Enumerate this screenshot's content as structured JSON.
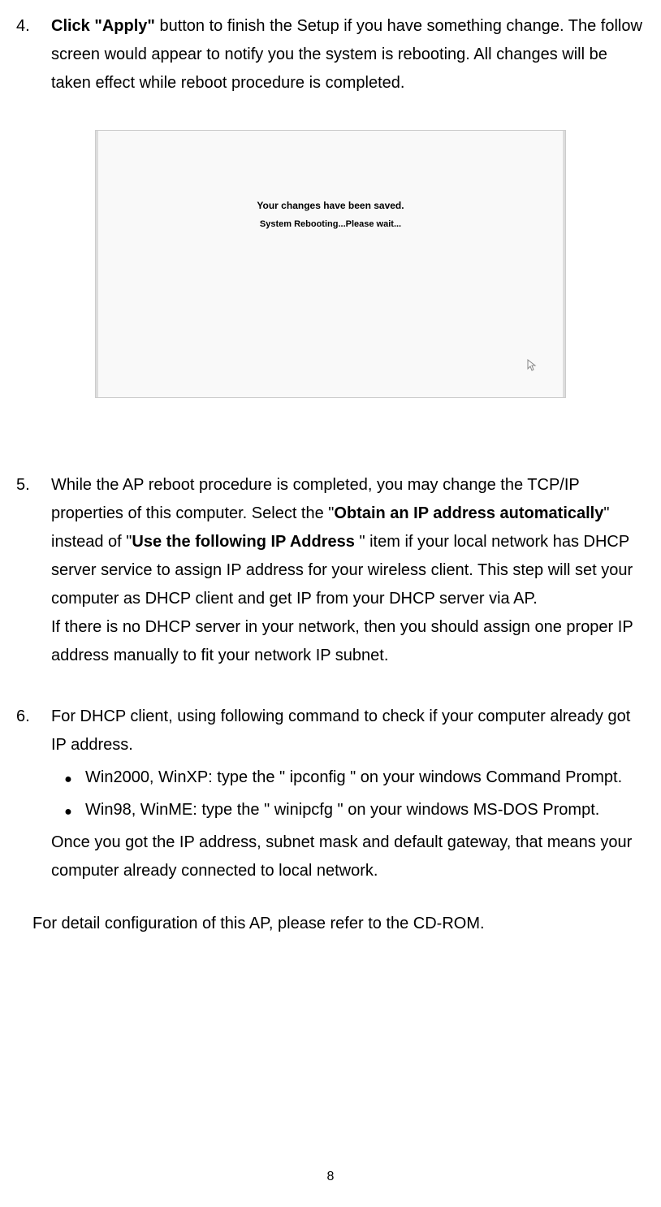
{
  "items": {
    "item4": {
      "number": "4.",
      "bold_lead": "Click \"Apply\"",
      "text_rest": " button to finish the Setup if you have something change. The follow screen would appear to notify you the system is rebooting. All changes will be taken effect while reboot procedure is completed."
    },
    "item5": {
      "number": "5.",
      "text_part1": "While the AP reboot procedure is completed, you may change the TCP/IP properties of this computer. Select the \"",
      "bold1": "Obtain an IP address automatically",
      "text_part2": "\" instead of \"",
      "bold2": "Use the following IP Address",
      "text_part3": " \" item if your local network has DHCP server service to assign IP address for your wireless client. This step will set your computer as DHCP client and get IP from your DHCP server via AP.",
      "text_part4": "If there is no DHCP server in your network, then you should assign one proper IP address manually to fit your network IP subnet."
    },
    "item6": {
      "number": "6.",
      "text_intro": "For DHCP client, using following command to check if your computer already got IP address.",
      "bullet1": "Win2000, WinXP: type the \" ipconfig \" on your windows Command Prompt.",
      "bullet2": "Win98, WinME: type the \" winipcfg \" on your windows MS-DOS Prompt.",
      "text_outro": "Once you got the IP address, subnet mask and default gateway, that means your computer already connected to local network."
    }
  },
  "screenshot": {
    "line1": "Your changes have been saved.",
    "line2": "System Rebooting...Please wait..."
  },
  "final_note": "For detail configuration of this AP, please refer to the CD-ROM.",
  "page_number": "8",
  "bullet_marker": "●"
}
